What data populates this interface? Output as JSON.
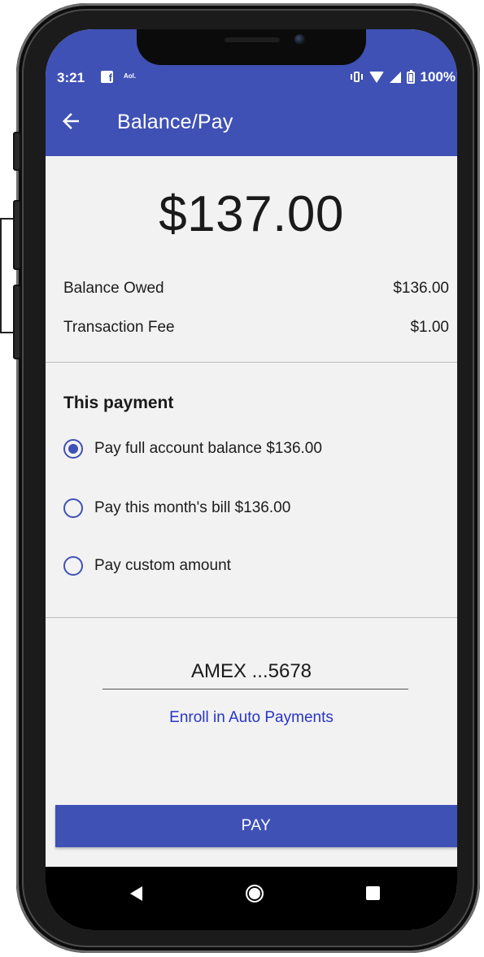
{
  "status_bar": {
    "time": "3:21",
    "fb_glyph": "f",
    "aol_label": "Aol.",
    "battery": "100%"
  },
  "app_bar": {
    "title": "Balance/Pay",
    "back_icon": "arrow-left-icon",
    "color": "#3f51b5"
  },
  "summary": {
    "total": "$137.00",
    "rows": [
      {
        "label": "Balance Owed",
        "value": "$136.00"
      },
      {
        "label": "Transaction Fee",
        "value": "$1.00"
      }
    ]
  },
  "payment": {
    "section_title": "This payment",
    "options": [
      {
        "label": "Pay full account balance $136.00",
        "selected": true
      },
      {
        "label": "Pay this month's bill $136.00",
        "selected": false
      },
      {
        "label": "Pay custom amount",
        "selected": false
      }
    ]
  },
  "card": {
    "label": "AMEX ...5678",
    "enroll_link": "Enroll in Auto Payments",
    "link_color": "#2835c8"
  },
  "pay_button": {
    "label": "PAY"
  },
  "nav_bar": {
    "icons": [
      "nav-back-icon",
      "nav-home-icon",
      "nav-recents-icon"
    ]
  }
}
